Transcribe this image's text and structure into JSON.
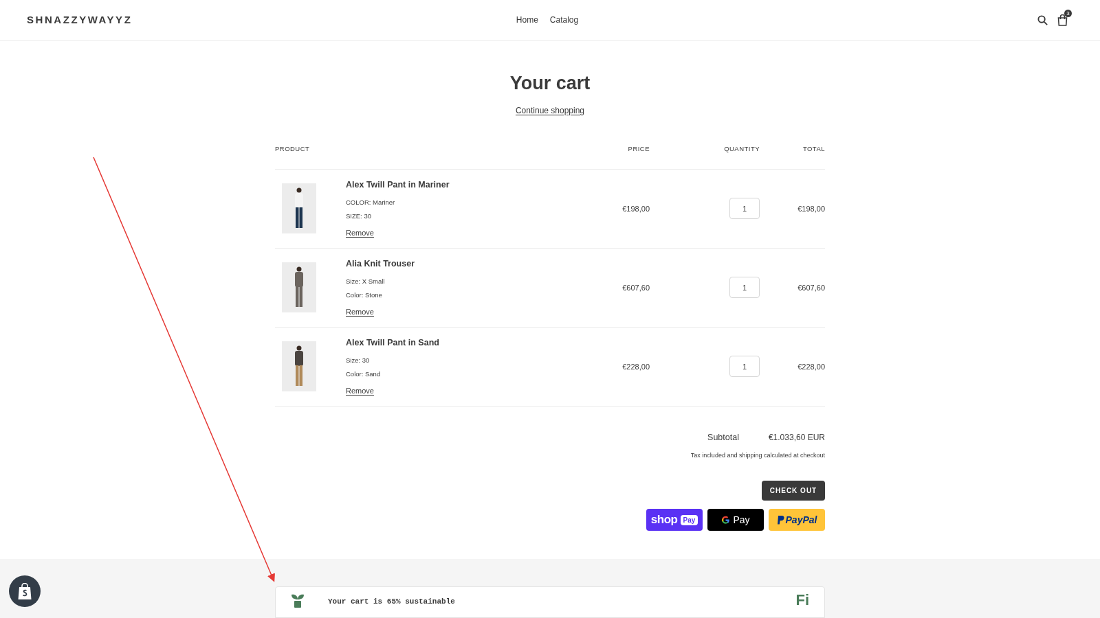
{
  "header": {
    "logo": "SHNAZZYWAYYZ",
    "nav": [
      {
        "label": "Home"
      },
      {
        "label": "Catalog"
      }
    ],
    "cart_count": "3"
  },
  "title": "Your cart",
  "continue_link": "Continue shopping",
  "table": {
    "columns": [
      "PRODUCT",
      "PRICE",
      "QUANTITY",
      "TOTAL"
    ],
    "rows": [
      {
        "name": "Alex Twill Pant in Mariner",
        "options": [
          "COLOR: Mariner",
          "SIZE: 30"
        ],
        "remove": "Remove",
        "price": "€198,00",
        "quantity": "1",
        "total": "€198,00"
      },
      {
        "name": "Alia Knit Trouser",
        "options": [
          "Size: X Small",
          "Color: Stone"
        ],
        "remove": "Remove",
        "price": "€607,60",
        "quantity": "1",
        "total": "€607,60"
      },
      {
        "name": "Alex Twill Pant in Sand",
        "options": [
          "Size: 30",
          "Color: Sand"
        ],
        "remove": "Remove",
        "price": "€228,00",
        "quantity": "1",
        "total": "€228,00"
      }
    ]
  },
  "subtotal": {
    "label": "Subtotal",
    "value": "€1.033,60 EUR",
    "note": "Tax included and shipping calculated at checkout"
  },
  "checkout": "CHECK OUT",
  "payments": [
    {
      "kind": "shop_pay",
      "label": "shop",
      "badge": "Pay"
    },
    {
      "kind": "google_pay",
      "label": "Pay"
    },
    {
      "kind": "paypal",
      "label": "PayPal"
    }
  ],
  "sustainability": {
    "message": "Your cart is 65% sustainable",
    "logo": "Fi"
  }
}
